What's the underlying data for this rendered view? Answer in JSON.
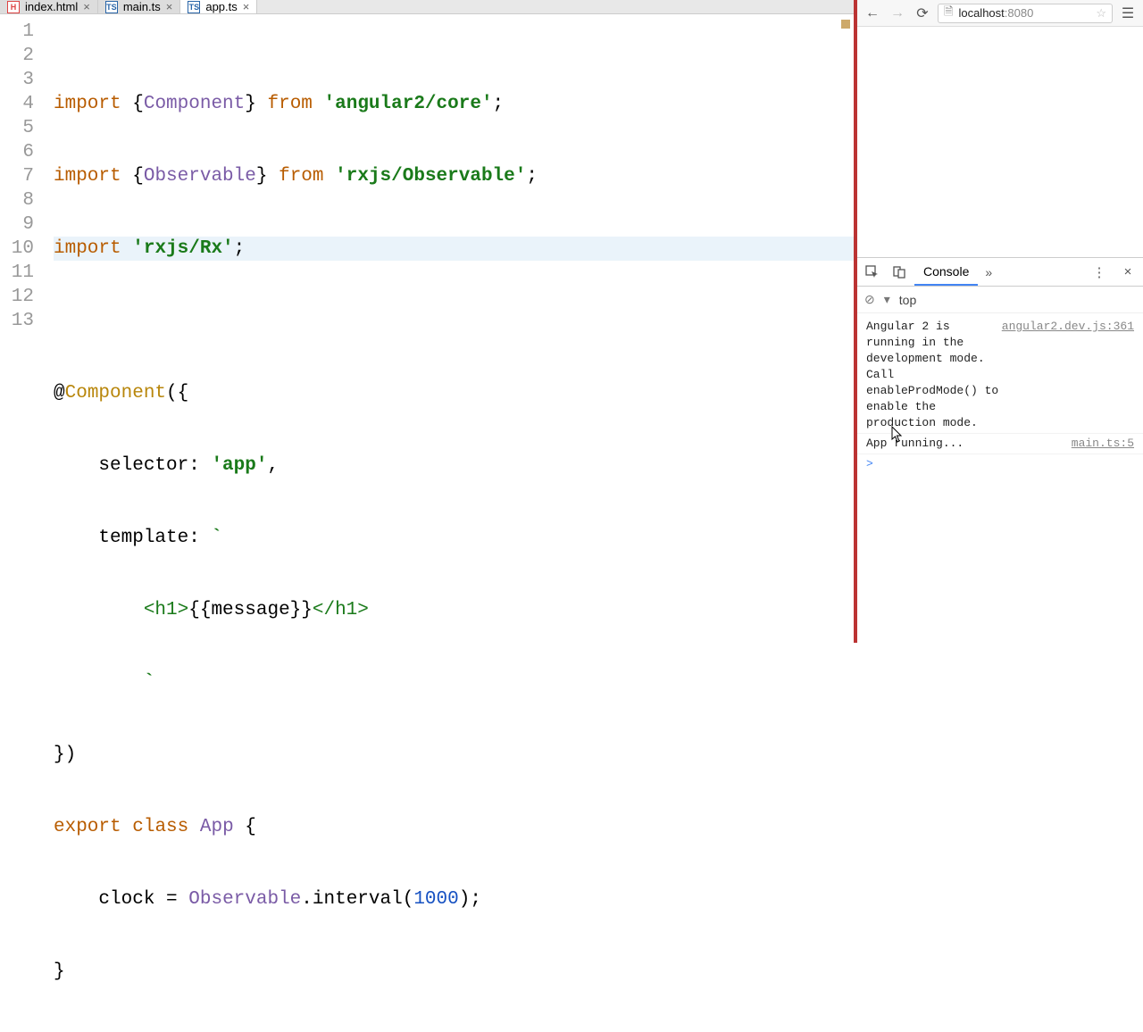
{
  "editor": {
    "tabs": [
      {
        "label": "index.html",
        "kind": "html",
        "active": false
      },
      {
        "label": "main.ts",
        "kind": "ts",
        "active": false
      },
      {
        "label": "app.ts",
        "kind": "ts",
        "active": true
      }
    ],
    "line_numbers": [
      "1",
      "2",
      "3",
      "4",
      "5",
      "6",
      "7",
      "8",
      "9",
      "10",
      "11",
      "12",
      "13"
    ],
    "highlighted_line": 3,
    "code": {
      "l1": {
        "kw1": "import",
        "name": "Component",
        "kw2": "from",
        "str": "'angular2/core'"
      },
      "l2": {
        "kw1": "import",
        "name": "Observable",
        "kw2": "from",
        "str": "'rxjs/Observable'"
      },
      "l3": {
        "kw1": "import",
        "str": "'rxjs/Rx'"
      },
      "l5": {
        "ann": "Component"
      },
      "l6": {
        "key": "selector:",
        "str": "'app'"
      },
      "l7": {
        "key": "template:"
      },
      "l8": {
        "open": "<h1>",
        "interp": "{{message}}",
        "close": "</h1>"
      },
      "l11": {
        "kw1": "export",
        "kw2": "class",
        "name": "App"
      },
      "l12": {
        "var": "clock",
        "eq": "=",
        "obs": "Observable",
        "method": ".interval(",
        "num": "1000",
        "end": ");"
      }
    }
  },
  "browser": {
    "address": {
      "host": "localhost",
      "port": ":8080"
    }
  },
  "devtools": {
    "tab_label": "Console",
    "context": "top",
    "messages": [
      {
        "text": "Angular 2 is running in the development mode. Call enableProdMode() to enable the production mode.",
        "src": "angular2.dev.js:361"
      },
      {
        "text": "App running...",
        "src": "main.ts:5"
      }
    ],
    "prompt": ">"
  }
}
